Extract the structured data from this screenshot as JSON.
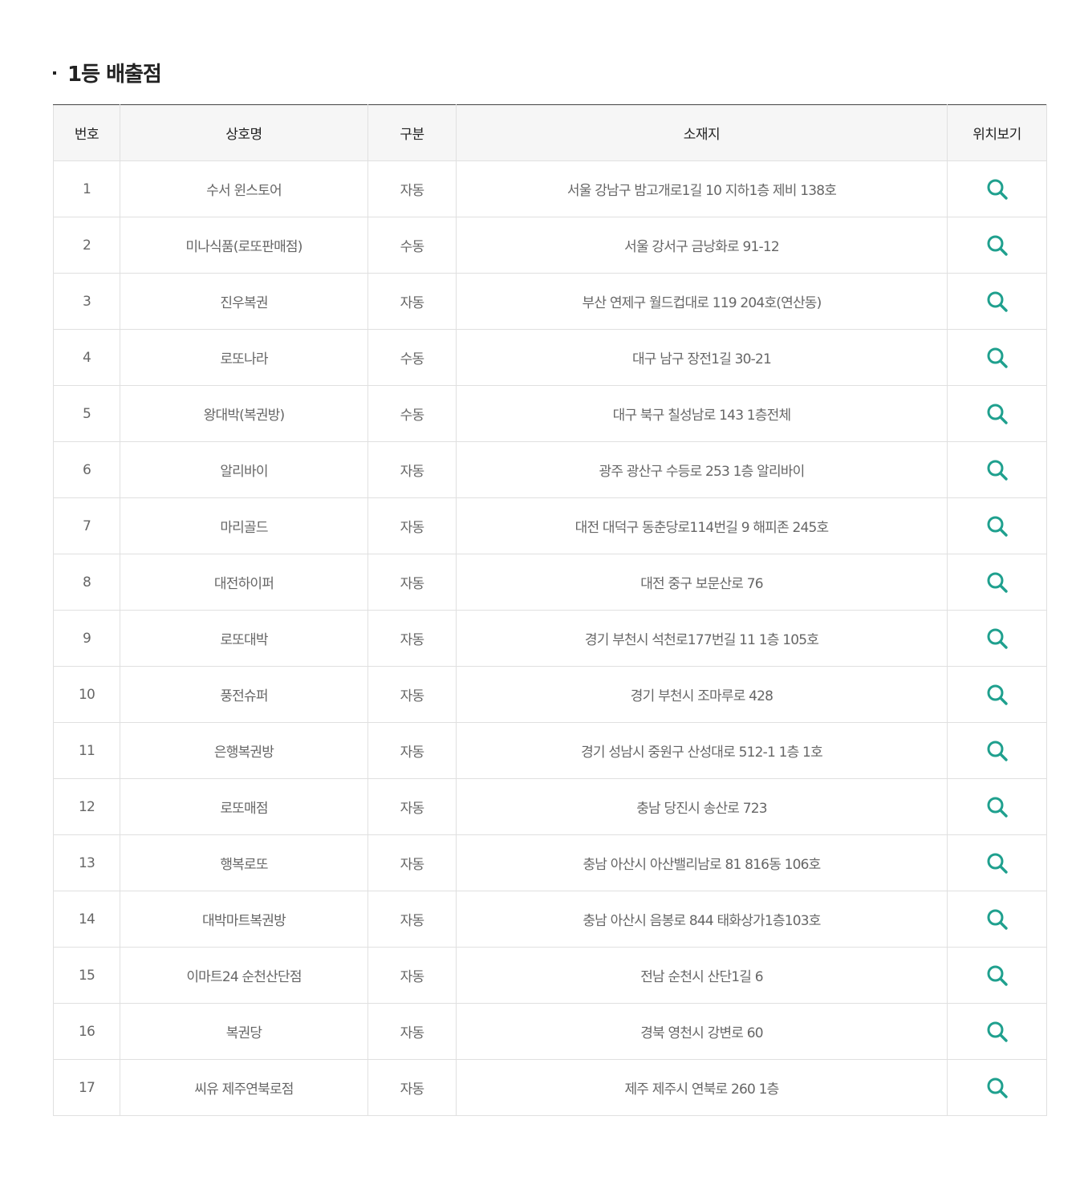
{
  "section": {
    "title": "1등 배출점"
  },
  "table": {
    "headers": {
      "no": "번호",
      "name": "상호명",
      "type": "구분",
      "address": "소재지",
      "map": "위치보기"
    },
    "rows": [
      {
        "no": "1",
        "name": "수서 윈스토어",
        "type": "자동",
        "address": "서울 강남구 밤고개로1길 10 지하1층 제비 138호"
      },
      {
        "no": "2",
        "name": "미나식품(로또판매점)",
        "type": "수동",
        "address": "서울 강서구 금낭화로 91-12"
      },
      {
        "no": "3",
        "name": "진우복권",
        "type": "자동",
        "address": "부산 연제구 월드컵대로 119 204호(연산동)"
      },
      {
        "no": "4",
        "name": "로또나라",
        "type": "수동",
        "address": "대구 남구 장전1길 30-21"
      },
      {
        "no": "5",
        "name": "왕대박(복권방)",
        "type": "수동",
        "address": "대구 북구 칠성남로 143 1층전체"
      },
      {
        "no": "6",
        "name": "알리바이",
        "type": "자동",
        "address": "광주 광산구 수등로 253 1층 알리바이"
      },
      {
        "no": "7",
        "name": "마리골드",
        "type": "자동",
        "address": "대전 대덕구 동춘당로114번길 9 해피존 245호"
      },
      {
        "no": "8",
        "name": "대전하이퍼",
        "type": "자동",
        "address": "대전 중구 보문산로 76"
      },
      {
        "no": "9",
        "name": "로또대박",
        "type": "자동",
        "address": "경기 부천시 석천로177번길 11 1층 105호"
      },
      {
        "no": "10",
        "name": "풍전슈퍼",
        "type": "자동",
        "address": "경기 부천시 조마루로 428"
      },
      {
        "no": "11",
        "name": "은행복권방",
        "type": "자동",
        "address": "경기 성남시 중원구 산성대로 512-1 1층 1호"
      },
      {
        "no": "12",
        "name": "로또매점",
        "type": "자동",
        "address": "충남 당진시 송산로 723"
      },
      {
        "no": "13",
        "name": "행복로또",
        "type": "자동",
        "address": "충남 아산시 아산밸리남로 81 816동 106호"
      },
      {
        "no": "14",
        "name": "대박마트복권방",
        "type": "자동",
        "address": "충남 아산시 음봉로 844 태화상가1층103호"
      },
      {
        "no": "15",
        "name": "이마트24 순천산단점",
        "type": "자동",
        "address": "전남 순천시 산단1길 6"
      },
      {
        "no": "16",
        "name": "복권당",
        "type": "자동",
        "address": "경북 영천시 강변로 60"
      },
      {
        "no": "17",
        "name": "씨유 제주연북로점",
        "type": "자동",
        "address": "제주 제주시 연북로 260 1층"
      }
    ]
  },
  "colors": {
    "accent": "#1fa08e",
    "header_bg": "#f6f6f6",
    "border": "#e0e0e0"
  },
  "icons": {
    "location": "search-icon"
  }
}
